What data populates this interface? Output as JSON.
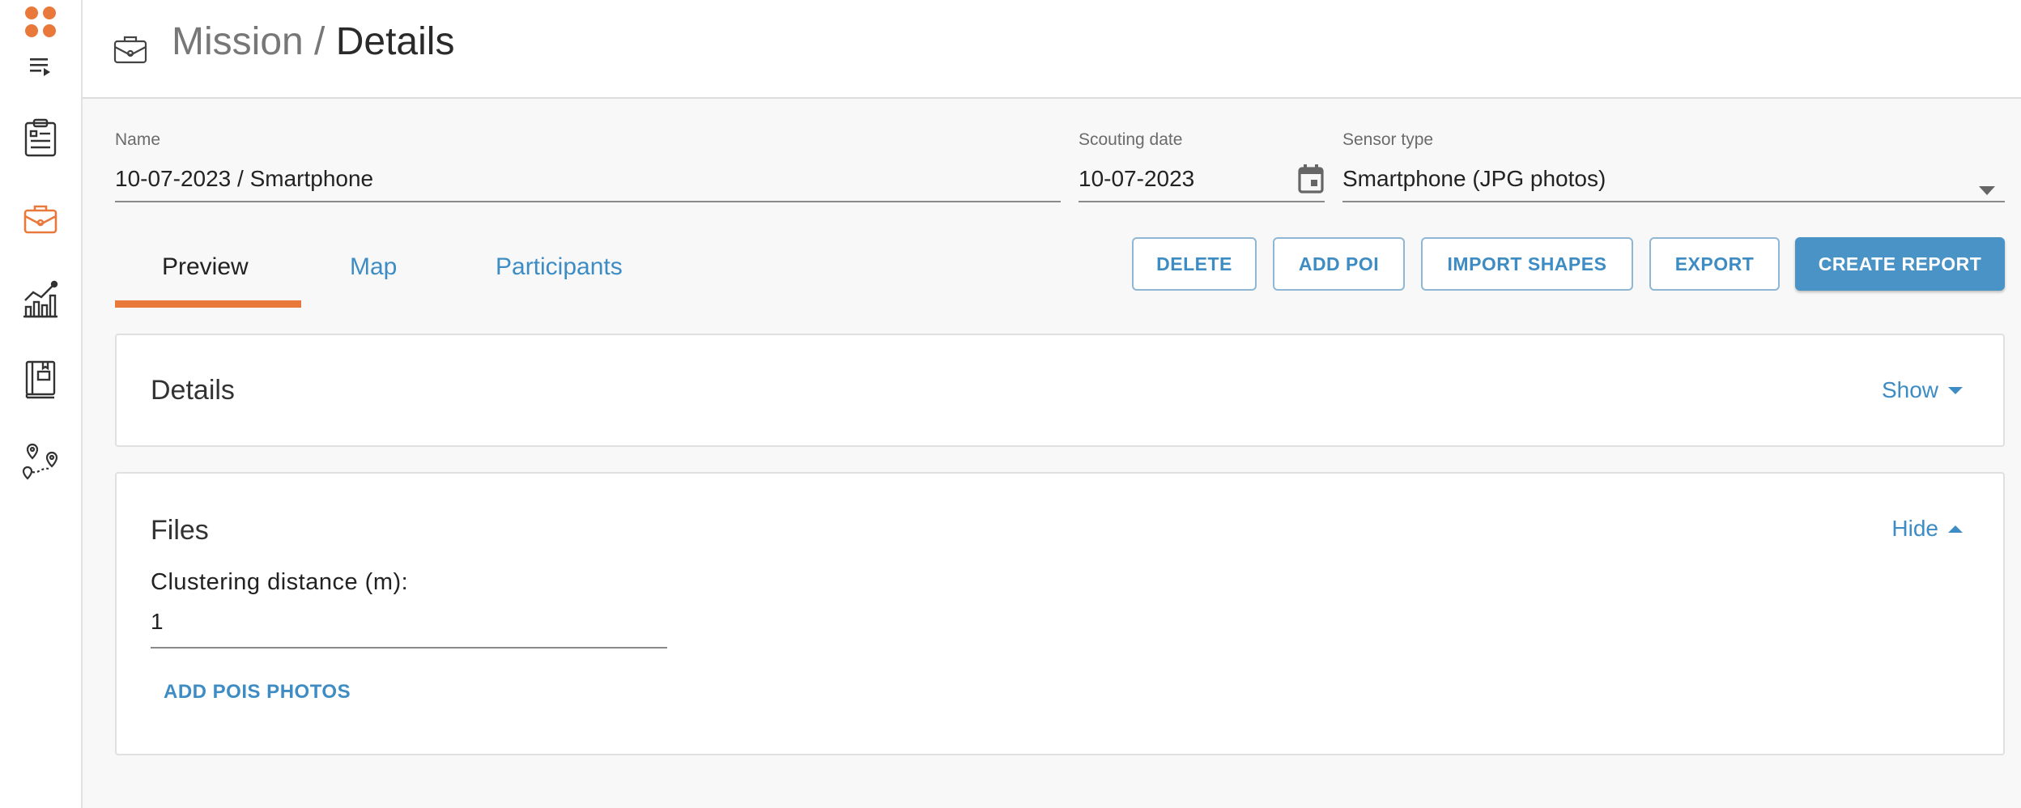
{
  "header": {
    "breadcrumb_parent": "Mission",
    "separator": "/",
    "current": "Details"
  },
  "form": {
    "name": {
      "label": "Name",
      "value": "10-07-2023 / Smartphone"
    },
    "scouting_date": {
      "label": "Scouting date",
      "value": "10-07-2023"
    },
    "sensor_type": {
      "label": "Sensor type",
      "value": "Smartphone (JPG photos)"
    }
  },
  "tabs": [
    {
      "label": "Preview",
      "active": true
    },
    {
      "label": "Map",
      "active": false
    },
    {
      "label": "Participants",
      "active": false
    }
  ],
  "actions": {
    "delete": "DELETE",
    "add_poi": "ADD POI",
    "import_shapes": "IMPORT SHAPES",
    "export": "EXPORT",
    "create_report": "CREATE REPORT"
  },
  "details_card": {
    "title": "Details",
    "toggle": "Show"
  },
  "files_card": {
    "title": "Files",
    "toggle": "Hide",
    "clustering_label": "Clustering distance (m):",
    "clustering_value": "1",
    "add_photos": "ADD POIS PHOTOS"
  },
  "sidebar": {
    "icons": [
      "apps-icon",
      "menu-expand-icon",
      "clipboard-icon",
      "briefcase-icon",
      "chart-icon",
      "book-icon",
      "route-icon"
    ],
    "active": "briefcase-icon"
  },
  "colors": {
    "accent": "#e8793a",
    "link": "#3d8cc4",
    "primary_button": "#4a93c6"
  }
}
